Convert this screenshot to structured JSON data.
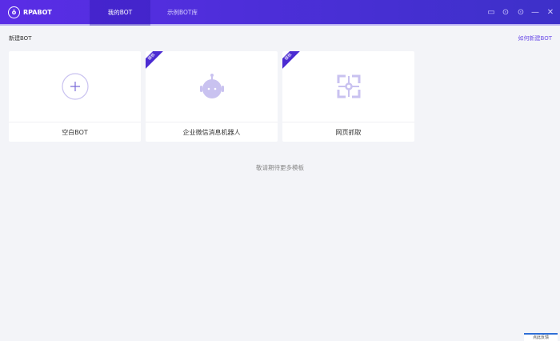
{
  "app": {
    "title": "RPABOT"
  },
  "tabs": [
    {
      "label": "我的BOT",
      "active": true
    },
    {
      "label": "示例BOT库",
      "active": false
    }
  ],
  "window_controls": [
    "chat-icon",
    "help-icon",
    "info-icon",
    "minimize-icon",
    "close-icon"
  ],
  "section": {
    "title": "新建BOT",
    "help_link": "如何新建BOT"
  },
  "cards": [
    {
      "label": "空白BOT",
      "icon": "plus-icon",
      "badge": null
    },
    {
      "label": "企业微信消息机器人",
      "icon": "robot-icon",
      "badge": "模板"
    },
    {
      "label": "网页抓取",
      "icon": "crosshair-icon",
      "badge": "模板"
    }
  ],
  "more_text": "敬请期待更多模板",
  "feedback": "点此反馈",
  "colors": {
    "accent": "#5a2de6",
    "icon": "#c9c2f0"
  }
}
